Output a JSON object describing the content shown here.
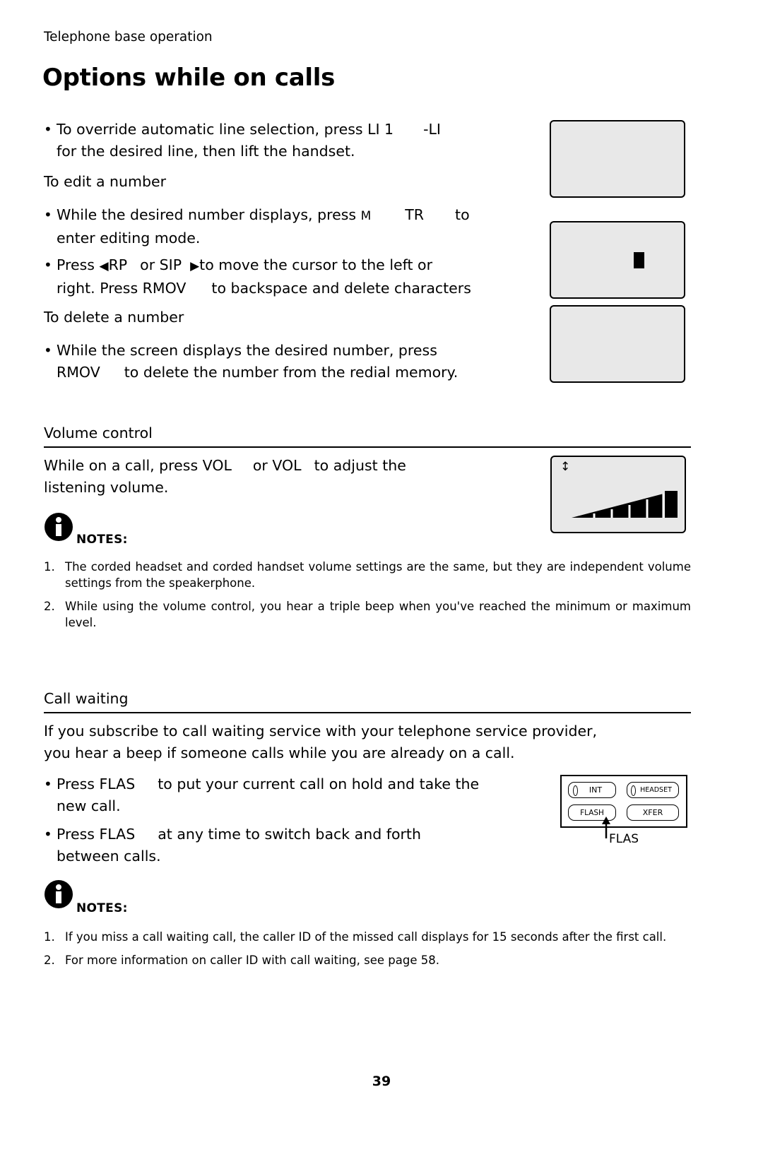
{
  "header": {
    "running_head": "Telephone base operation",
    "title": "Options while on calls"
  },
  "line_selection": {
    "bullet_text_1": "To override automatic line selection, press ",
    "key_1": "LI 1",
    "key_2": "-LI",
    "bullet_text_2": "for the desired line, then lift the handset."
  },
  "edit_number": {
    "subhead": "To edit a number",
    "bullets": [
      {
        "part1": "While the desired number displays, press ",
        "key1": "M",
        "part2": "TR",
        "part3": "to",
        "line2": "enter editing mode."
      },
      {
        "part1": "Press ",
        "key1": "RP",
        "part2": "or SIP",
        "part3": "to move the cursor to the left or",
        "line2a": "right. Press ",
        "key2": "RMOV",
        "line2b": "to backspace and delete characters"
      }
    ]
  },
  "delete_number": {
    "subhead": "To delete a number",
    "bullet": {
      "line1": "While the screen displays the desired number, press",
      "key": "RMOV",
      "line2": "to delete the number from the redial memory."
    }
  },
  "volume_control": {
    "heading": "Volume control",
    "body_part1": "While on a call, press ",
    "key1": "VOL",
    "body_part2": "or VOL",
    "body_part3": "to adjust the",
    "body_line2": "listening volume.",
    "notes_label": "NOTES:",
    "notes": [
      {
        "num": "1.",
        "text": "The corded headset and corded handset volume settings are the same, but they are independent volume settings from the speakerphone."
      },
      {
        "num": "2.",
        "text": "While using the volume control, you hear a triple beep when you've reached the minimum or maximum level."
      }
    ]
  },
  "call_waiting": {
    "heading": "Call waiting",
    "intro_line1": "If you subscribe to call waiting service with your telephone service provider,",
    "intro_line2": "you hear a beep if someone calls while you are already on a call.",
    "bullets": [
      {
        "part1": "Press ",
        "key": "FLAS",
        "part2": "to put your current call on hold and take the",
        "line2": "new call."
      },
      {
        "part1": "Press ",
        "key": "FLAS",
        "part2": "at any time to switch back and forth",
        "line2": "between calls."
      }
    ],
    "notes_label": "NOTES:",
    "notes": [
      {
        "num": "1.",
        "text": "If you miss a call waiting call, the caller ID of the missed call displays for 15 seconds after the first call."
      },
      {
        "num": "2.",
        "text": "For more information on caller ID with call waiting, see page 58."
      }
    ],
    "keypad": {
      "int_label": "INT",
      "headset_label": "HEADSET",
      "flash_label": "FLASH",
      "xfer_label": "XFER",
      "caption": "FLAS"
    }
  },
  "footer": {
    "page_number": "39"
  }
}
